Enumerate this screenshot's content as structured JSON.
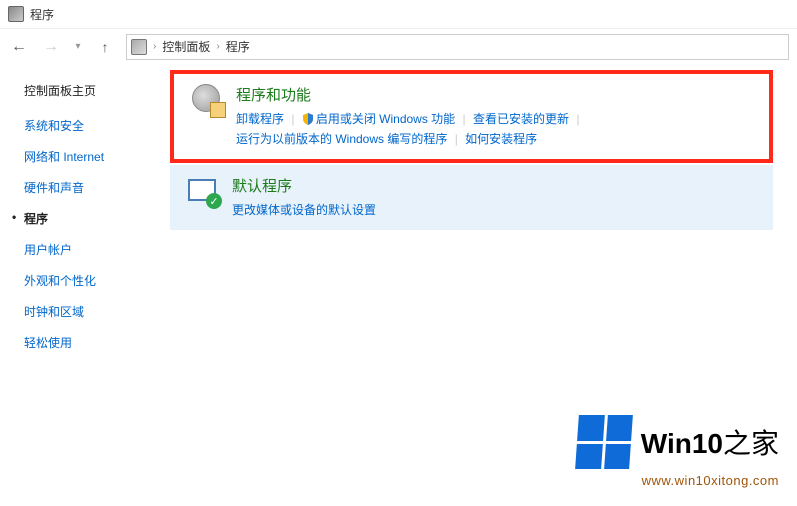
{
  "window": {
    "title": "程序"
  },
  "breadcrumb": {
    "root": "控制面板",
    "current": "程序"
  },
  "sidebar": {
    "home": "控制面板主页",
    "items": [
      {
        "label": "系统和安全",
        "active": false
      },
      {
        "label": "网络和 Internet",
        "active": false
      },
      {
        "label": "硬件和声音",
        "active": false
      },
      {
        "label": "程序",
        "active": true
      },
      {
        "label": "用户帐户",
        "active": false
      },
      {
        "label": "外观和个性化",
        "active": false
      },
      {
        "label": "时钟和区域",
        "active": false
      },
      {
        "label": "轻松使用",
        "active": false
      }
    ]
  },
  "sections": [
    {
      "title": "程序和功能",
      "highlight": true,
      "links": [
        {
          "label": "卸载程序",
          "shield": false
        },
        {
          "label": "启用或关闭 Windows 功能",
          "shield": true
        },
        {
          "label": "查看已安装的更新",
          "shield": false
        },
        {
          "label": "运行为以前版本的 Windows 编写的程序",
          "shield": false
        },
        {
          "label": "如何安装程序",
          "shield": false
        }
      ]
    },
    {
      "title": "默认程序",
      "highlight": false,
      "links": [
        {
          "label": "更改媒体或设备的默认设置",
          "shield": false
        }
      ]
    }
  ],
  "watermark": {
    "brand_prefix": "Win10",
    "brand_suffix": "之家",
    "url": "www.win10xitong.com"
  }
}
